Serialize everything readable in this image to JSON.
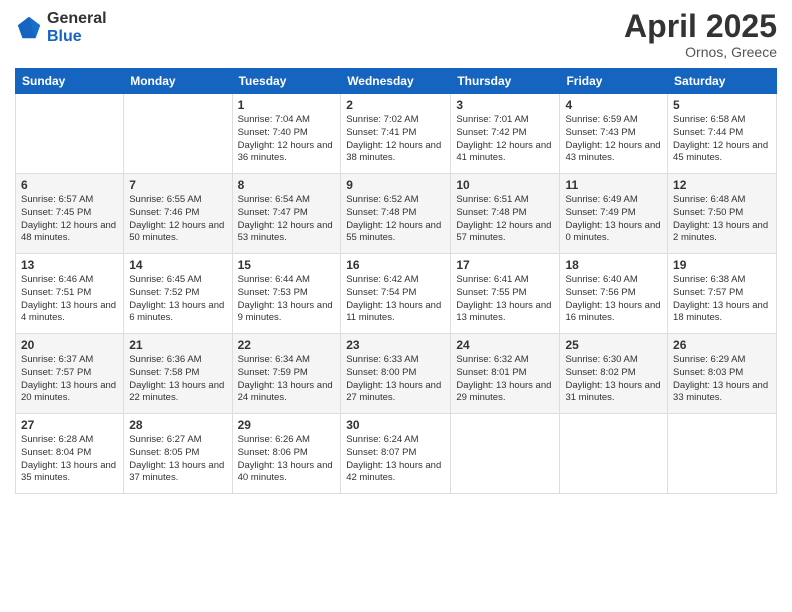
{
  "header": {
    "logo_line1": "General",
    "logo_line2": "Blue",
    "month": "April 2025",
    "location": "Ornos, Greece"
  },
  "days_of_week": [
    "Sunday",
    "Monday",
    "Tuesday",
    "Wednesday",
    "Thursday",
    "Friday",
    "Saturday"
  ],
  "weeks": [
    [
      {
        "day": "",
        "sunrise": "",
        "sunset": "",
        "daylight": ""
      },
      {
        "day": "",
        "sunrise": "",
        "sunset": "",
        "daylight": ""
      },
      {
        "day": "1",
        "sunrise": "Sunrise: 7:04 AM",
        "sunset": "Sunset: 7:40 PM",
        "daylight": "Daylight: 12 hours and 36 minutes."
      },
      {
        "day": "2",
        "sunrise": "Sunrise: 7:02 AM",
        "sunset": "Sunset: 7:41 PM",
        "daylight": "Daylight: 12 hours and 38 minutes."
      },
      {
        "day": "3",
        "sunrise": "Sunrise: 7:01 AM",
        "sunset": "Sunset: 7:42 PM",
        "daylight": "Daylight: 12 hours and 41 minutes."
      },
      {
        "day": "4",
        "sunrise": "Sunrise: 6:59 AM",
        "sunset": "Sunset: 7:43 PM",
        "daylight": "Daylight: 12 hours and 43 minutes."
      },
      {
        "day": "5",
        "sunrise": "Sunrise: 6:58 AM",
        "sunset": "Sunset: 7:44 PM",
        "daylight": "Daylight: 12 hours and 45 minutes."
      }
    ],
    [
      {
        "day": "6",
        "sunrise": "Sunrise: 6:57 AM",
        "sunset": "Sunset: 7:45 PM",
        "daylight": "Daylight: 12 hours and 48 minutes."
      },
      {
        "day": "7",
        "sunrise": "Sunrise: 6:55 AM",
        "sunset": "Sunset: 7:46 PM",
        "daylight": "Daylight: 12 hours and 50 minutes."
      },
      {
        "day": "8",
        "sunrise": "Sunrise: 6:54 AM",
        "sunset": "Sunset: 7:47 PM",
        "daylight": "Daylight: 12 hours and 53 minutes."
      },
      {
        "day": "9",
        "sunrise": "Sunrise: 6:52 AM",
        "sunset": "Sunset: 7:48 PM",
        "daylight": "Daylight: 12 hours and 55 minutes."
      },
      {
        "day": "10",
        "sunrise": "Sunrise: 6:51 AM",
        "sunset": "Sunset: 7:48 PM",
        "daylight": "Daylight: 12 hours and 57 minutes."
      },
      {
        "day": "11",
        "sunrise": "Sunrise: 6:49 AM",
        "sunset": "Sunset: 7:49 PM",
        "daylight": "Daylight: 13 hours and 0 minutes."
      },
      {
        "day": "12",
        "sunrise": "Sunrise: 6:48 AM",
        "sunset": "Sunset: 7:50 PM",
        "daylight": "Daylight: 13 hours and 2 minutes."
      }
    ],
    [
      {
        "day": "13",
        "sunrise": "Sunrise: 6:46 AM",
        "sunset": "Sunset: 7:51 PM",
        "daylight": "Daylight: 13 hours and 4 minutes."
      },
      {
        "day": "14",
        "sunrise": "Sunrise: 6:45 AM",
        "sunset": "Sunset: 7:52 PM",
        "daylight": "Daylight: 13 hours and 6 minutes."
      },
      {
        "day": "15",
        "sunrise": "Sunrise: 6:44 AM",
        "sunset": "Sunset: 7:53 PM",
        "daylight": "Daylight: 13 hours and 9 minutes."
      },
      {
        "day": "16",
        "sunrise": "Sunrise: 6:42 AM",
        "sunset": "Sunset: 7:54 PM",
        "daylight": "Daylight: 13 hours and 11 minutes."
      },
      {
        "day": "17",
        "sunrise": "Sunrise: 6:41 AM",
        "sunset": "Sunset: 7:55 PM",
        "daylight": "Daylight: 13 hours and 13 minutes."
      },
      {
        "day": "18",
        "sunrise": "Sunrise: 6:40 AM",
        "sunset": "Sunset: 7:56 PM",
        "daylight": "Daylight: 13 hours and 16 minutes."
      },
      {
        "day": "19",
        "sunrise": "Sunrise: 6:38 AM",
        "sunset": "Sunset: 7:57 PM",
        "daylight": "Daylight: 13 hours and 18 minutes."
      }
    ],
    [
      {
        "day": "20",
        "sunrise": "Sunrise: 6:37 AM",
        "sunset": "Sunset: 7:57 PM",
        "daylight": "Daylight: 13 hours and 20 minutes."
      },
      {
        "day": "21",
        "sunrise": "Sunrise: 6:36 AM",
        "sunset": "Sunset: 7:58 PM",
        "daylight": "Daylight: 13 hours and 22 minutes."
      },
      {
        "day": "22",
        "sunrise": "Sunrise: 6:34 AM",
        "sunset": "Sunset: 7:59 PM",
        "daylight": "Daylight: 13 hours and 24 minutes."
      },
      {
        "day": "23",
        "sunrise": "Sunrise: 6:33 AM",
        "sunset": "Sunset: 8:00 PM",
        "daylight": "Daylight: 13 hours and 27 minutes."
      },
      {
        "day": "24",
        "sunrise": "Sunrise: 6:32 AM",
        "sunset": "Sunset: 8:01 PM",
        "daylight": "Daylight: 13 hours and 29 minutes."
      },
      {
        "day": "25",
        "sunrise": "Sunrise: 6:30 AM",
        "sunset": "Sunset: 8:02 PM",
        "daylight": "Daylight: 13 hours and 31 minutes."
      },
      {
        "day": "26",
        "sunrise": "Sunrise: 6:29 AM",
        "sunset": "Sunset: 8:03 PM",
        "daylight": "Daylight: 13 hours and 33 minutes."
      }
    ],
    [
      {
        "day": "27",
        "sunrise": "Sunrise: 6:28 AM",
        "sunset": "Sunset: 8:04 PM",
        "daylight": "Daylight: 13 hours and 35 minutes."
      },
      {
        "day": "28",
        "sunrise": "Sunrise: 6:27 AM",
        "sunset": "Sunset: 8:05 PM",
        "daylight": "Daylight: 13 hours and 37 minutes."
      },
      {
        "day": "29",
        "sunrise": "Sunrise: 6:26 AM",
        "sunset": "Sunset: 8:06 PM",
        "daylight": "Daylight: 13 hours and 40 minutes."
      },
      {
        "day": "30",
        "sunrise": "Sunrise: 6:24 AM",
        "sunset": "Sunset: 8:07 PM",
        "daylight": "Daylight: 13 hours and 42 minutes."
      },
      {
        "day": "",
        "sunrise": "",
        "sunset": "",
        "daylight": ""
      },
      {
        "day": "",
        "sunrise": "",
        "sunset": "",
        "daylight": ""
      },
      {
        "day": "",
        "sunrise": "",
        "sunset": "",
        "daylight": ""
      }
    ]
  ]
}
